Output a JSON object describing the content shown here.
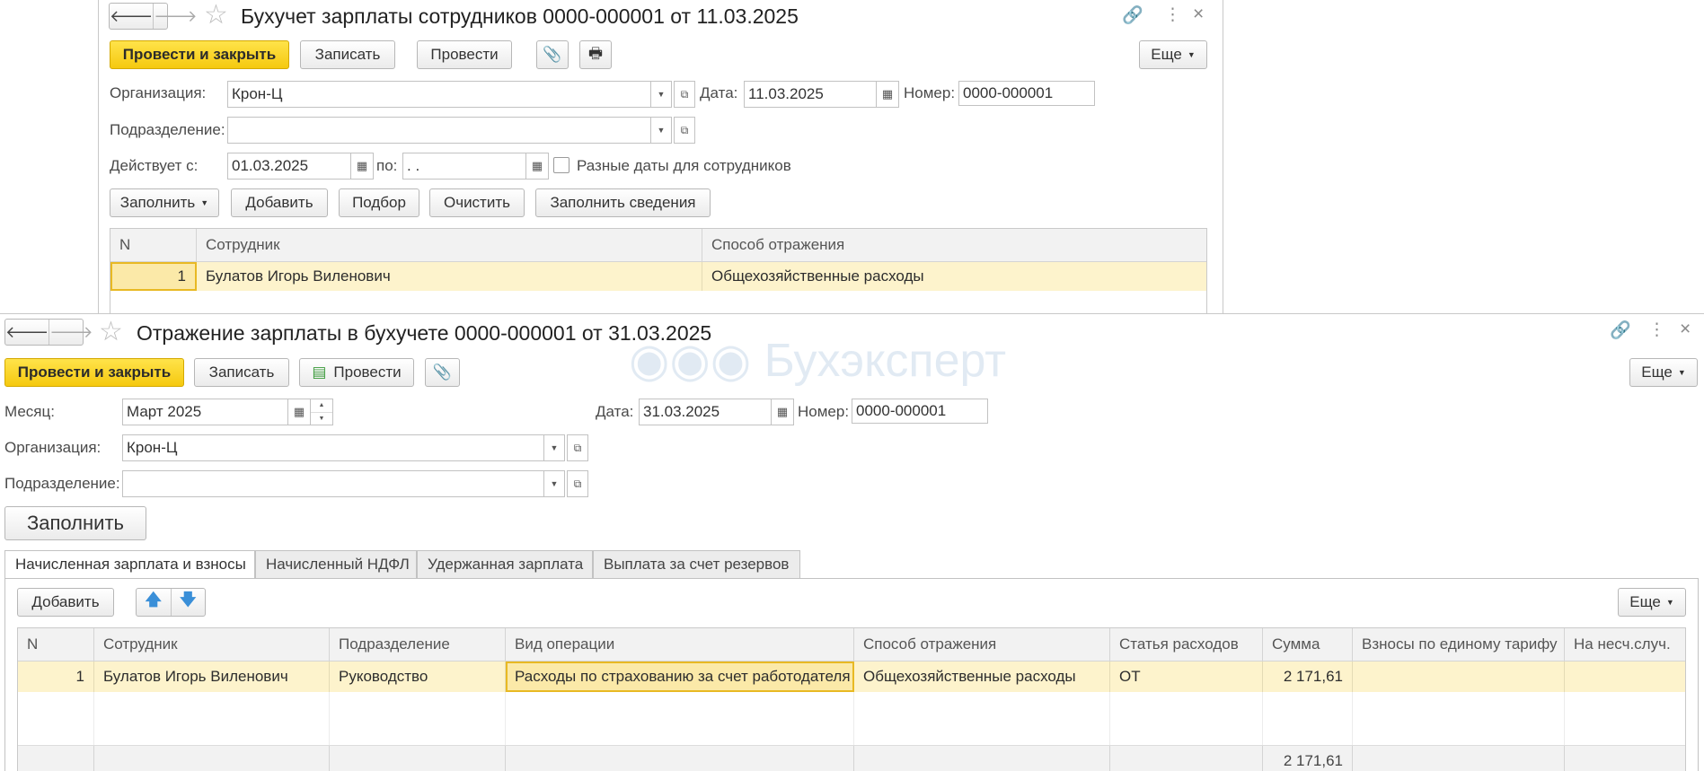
{
  "doc1": {
    "title": "Бухучет зарплаты сотрудников 0000-000001 от 11.03.2025",
    "nav_back": "🡐",
    "nav_fwd": "🡒",
    "buttons": {
      "post_close": "Провести и закрыть",
      "save": "Записать",
      "post": "Провести",
      "more": "Еще",
      "fill": "Заполнить",
      "add": "Добавить",
      "select": "Подбор",
      "clear": "Очистить",
      "fill_info": "Заполнить сведения"
    },
    "fields": {
      "org_label": "Организация:",
      "org_value": "Крон-Ц",
      "date_label": "Дата:",
      "date_value": "11.03.2025",
      "number_label": "Номер:",
      "number_value": "0000-000001",
      "dept_label": "Подразделение:",
      "dept_value": "",
      "valid_from_label": "Действует с:",
      "valid_from_value": "01.03.2025",
      "to_label": "по:",
      "to_value": " .  .",
      "diff_dates_label": "Разные даты для сотрудников"
    },
    "table": {
      "headers": [
        "N",
        "Сотрудник",
        "Способ отражения"
      ],
      "rows": [
        {
          "n": "1",
          "employee": "Булатов Игорь Виленович",
          "method": "Общехозяйственные расходы"
        }
      ]
    }
  },
  "doc2": {
    "title": "Отражение зарплаты в бухучете 0000-000001 от 31.03.2025",
    "watermark": "Бухэксперт",
    "buttons": {
      "post_close": "Провести и закрыть",
      "save": "Записать",
      "post": "Провести",
      "more": "Еще",
      "fill": "Заполнить",
      "add": "Добавить",
      "table_more": "Еще"
    },
    "fields": {
      "month_label": "Месяц:",
      "month_value": "Март 2025",
      "date_label": "Дата:",
      "date_value": "31.03.2025",
      "number_label": "Номер:",
      "number_value": "0000-000001",
      "org_label": "Организация:",
      "org_value": "Крон-Ц",
      "dept_label": "Подразделение:",
      "dept_value": ""
    },
    "tabs": [
      "Начисленная зарплата и взносы",
      "Начисленный НДФЛ",
      "Удержанная зарплата",
      "Выплата за счет резервов"
    ],
    "table": {
      "headers": [
        "N",
        "Сотрудник",
        "Подразделение",
        "Вид операции",
        "Способ отражения",
        "Статья расходов",
        "Сумма",
        "Взносы по единому тарифу",
        "На несч.случ."
      ],
      "rows": [
        {
          "n": "1",
          "employee": "Булатов Игорь Виленович",
          "dept": "Руководство",
          "operation": "Расходы по страхованию за счет работодателя",
          "method": "Общехозяйственные расходы",
          "expense": "ОТ",
          "sum": "2 171,61",
          "contrib": "",
          "accident": ""
        }
      ],
      "footer_sum": "2 171,61"
    }
  },
  "colors": {
    "primary_button": "#f5c90f",
    "selected_row": "#fdf3cc",
    "active_cell_border": "#e8b923",
    "underline": "#d42020",
    "arrow_blue": "#3a8fd8"
  }
}
